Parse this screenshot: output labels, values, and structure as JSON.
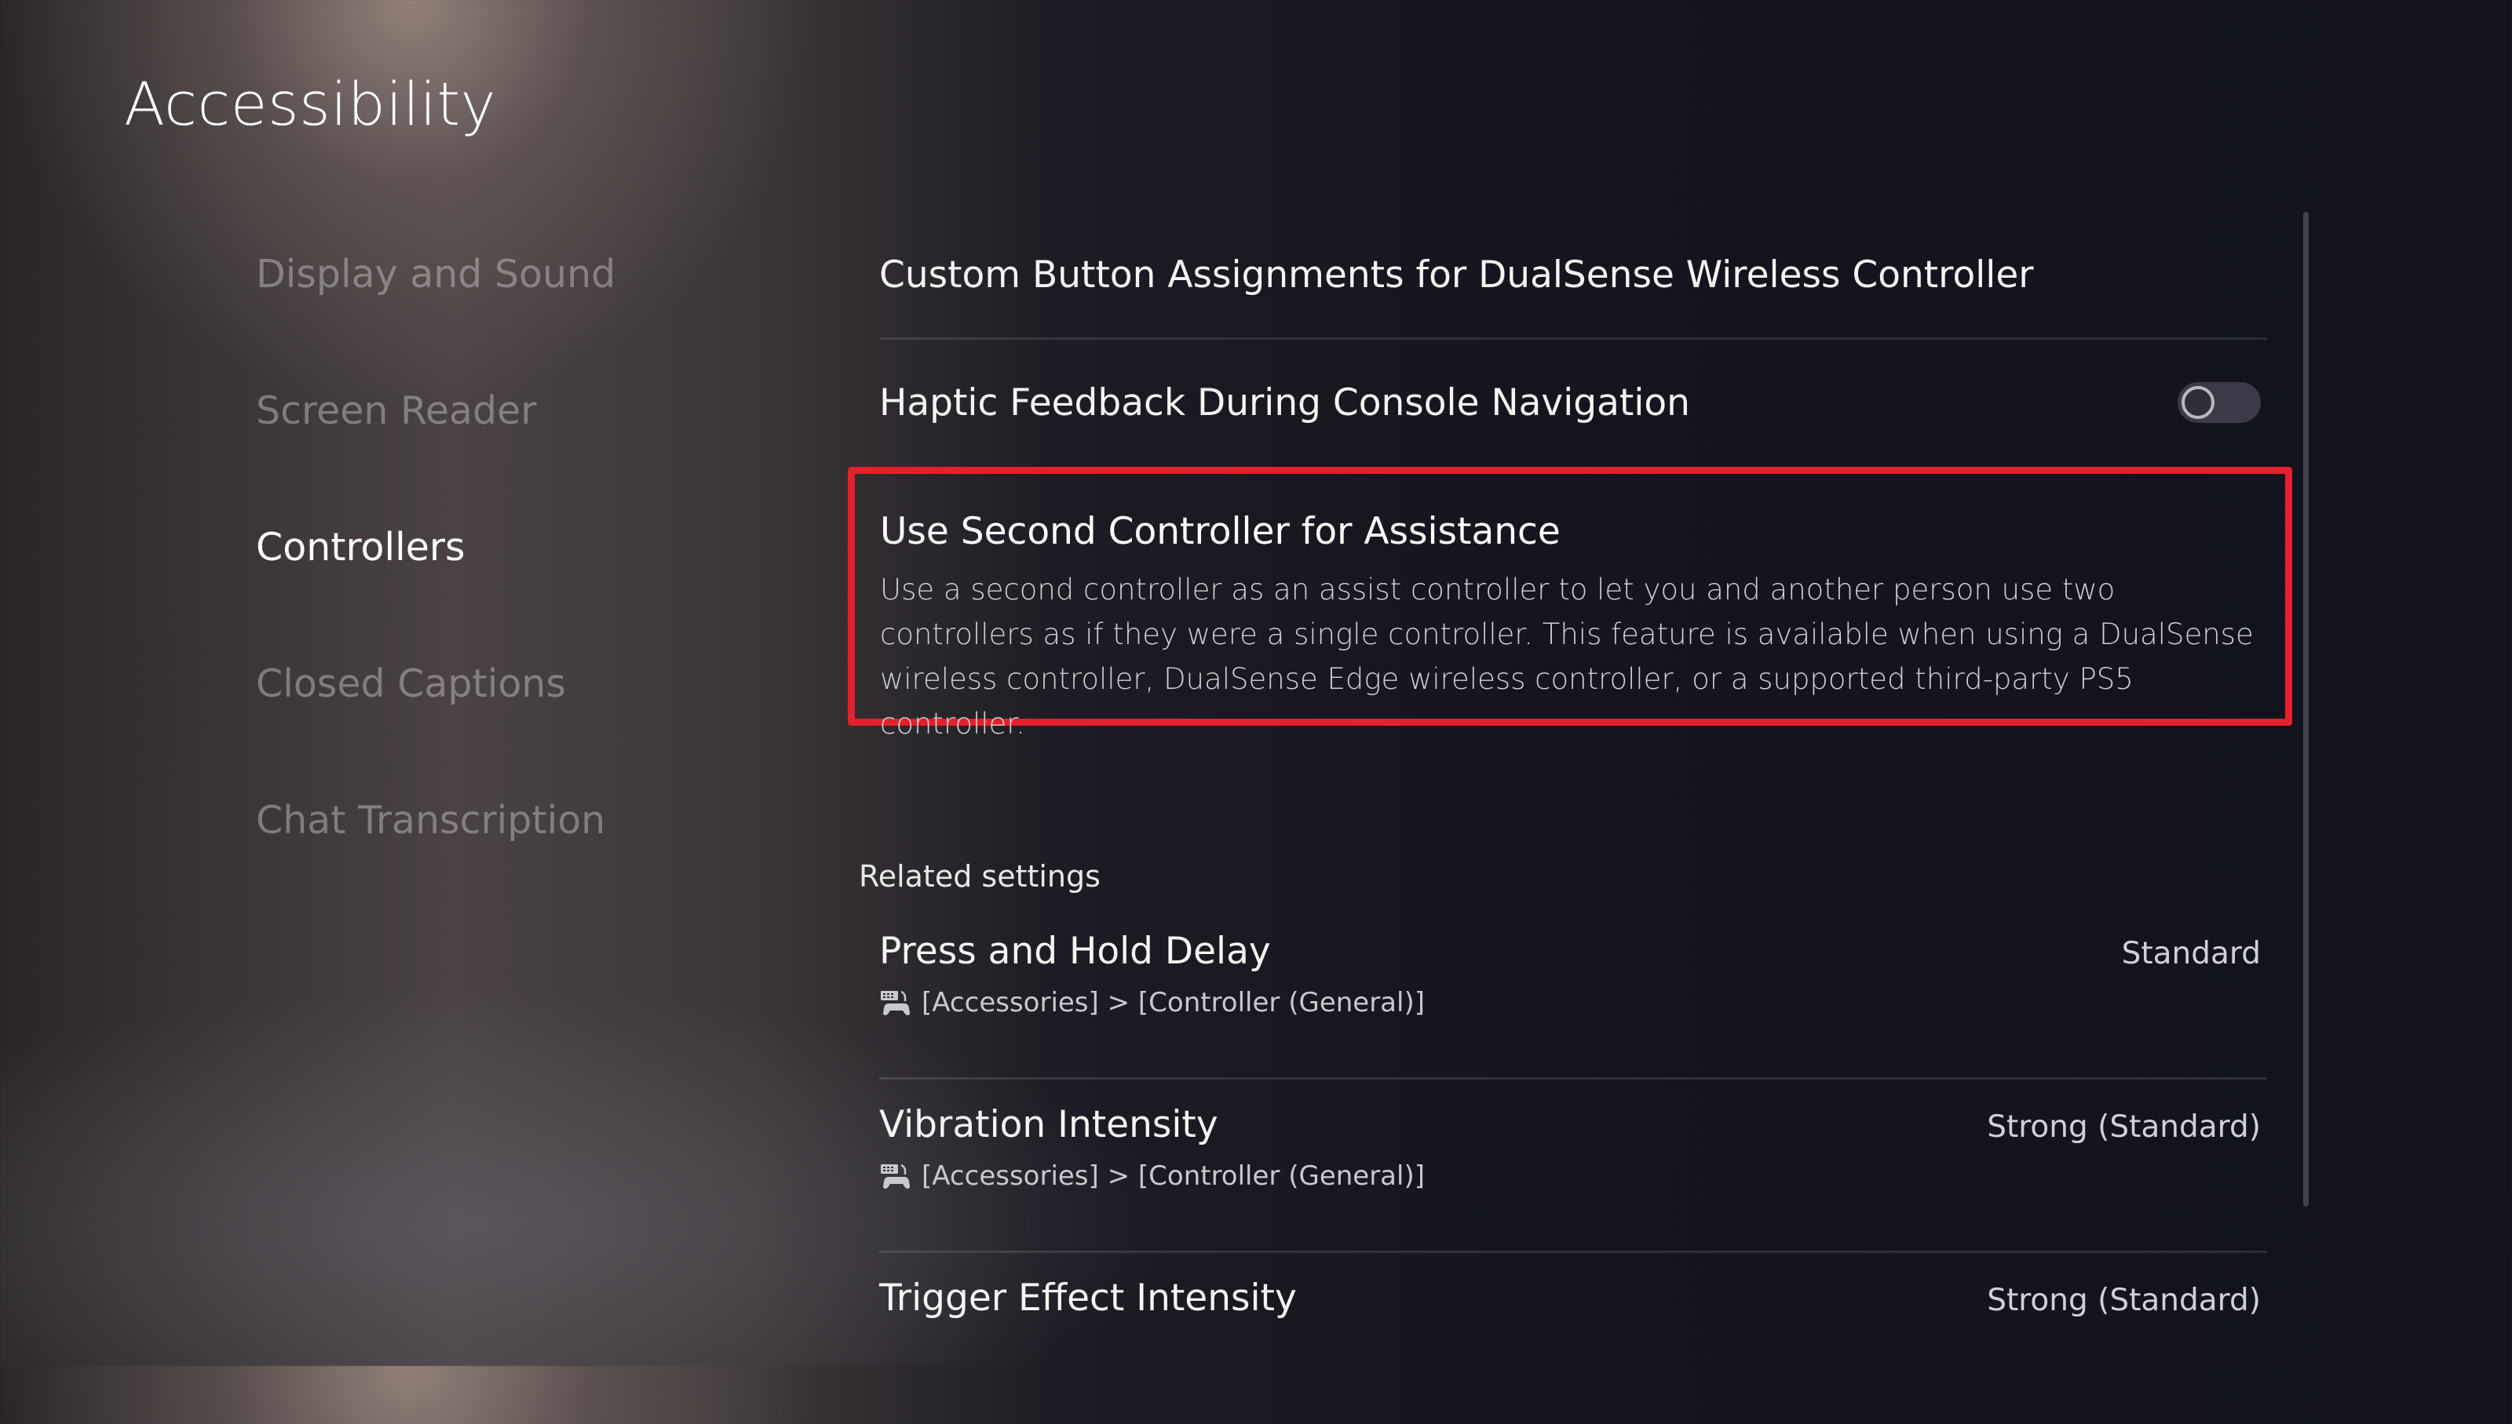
{
  "page": {
    "title": "Accessibility"
  },
  "nav": {
    "items": [
      {
        "label": "Display and Sound",
        "active": false
      },
      {
        "label": "Screen Reader",
        "active": false
      },
      {
        "label": "Controllers",
        "active": true
      },
      {
        "label": "Closed Captions",
        "active": false
      },
      {
        "label": "Chat Transcription",
        "active": false
      }
    ]
  },
  "settings": {
    "custom_buttons": {
      "label": "Custom Button Assignments for DualSense Wireless Controller"
    },
    "haptic": {
      "label": "Haptic Feedback During Console Navigation",
      "toggle_state": "off"
    },
    "assist": {
      "label": "Use Second Controller for Assistance",
      "description": "Use a second controller as an assist controller to let you and another person use two controllers as if they were a single controller. This feature is available when using a DualSense wireless controller, DualSense Edge wireless controller, or a supported third-party PS5 controller.",
      "highlight_color": "#e4202a"
    }
  },
  "related": {
    "header": "Related settings",
    "items": [
      {
        "label": "Press and Hold Delay",
        "value": "Standard",
        "path": "[Accessories] > [Controller (General)]",
        "icon": "gamepad-keyboard-icon"
      },
      {
        "label": "Vibration Intensity",
        "value": "Strong (Standard)",
        "path": "[Accessories] > [Controller (General)]",
        "icon": "gamepad-keyboard-icon"
      },
      {
        "label": "Trigger Effect Intensity",
        "value": "Strong (Standard)"
      }
    ]
  }
}
